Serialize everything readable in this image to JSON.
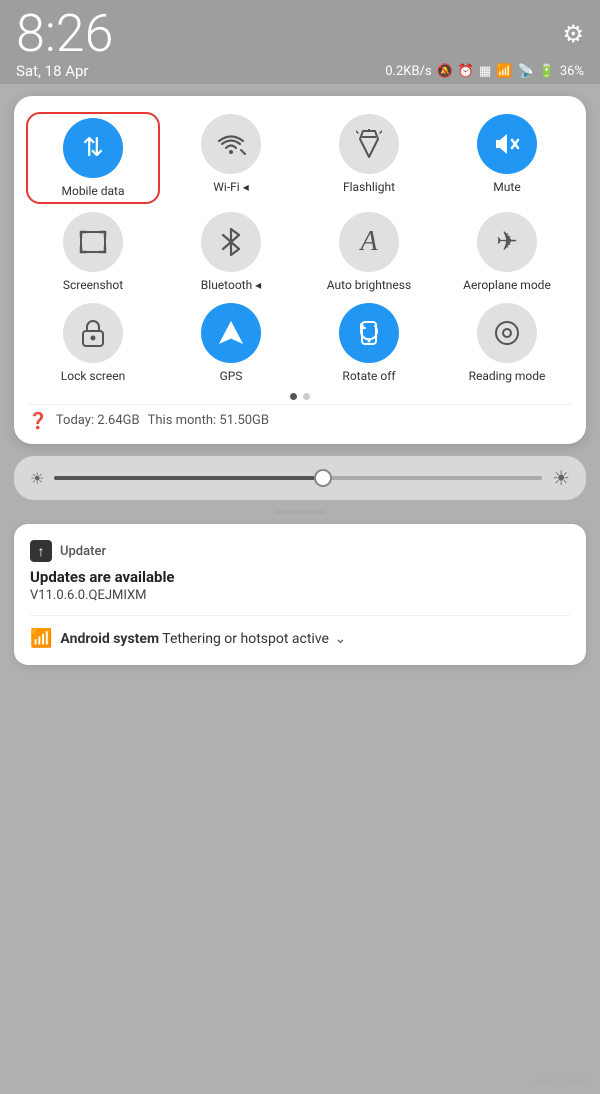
{
  "statusBar": {
    "time": "8:26",
    "date": "Sat, 18 Apr",
    "speed": "0.2KB/s",
    "battery": "36%"
  },
  "quickPanel": {
    "tiles": [
      {
        "id": "mobile-data",
        "label": "Mobile data",
        "icon": "⇅",
        "active": true,
        "selected": true
      },
      {
        "id": "wifi",
        "label": "Wi-Fi",
        "icon": "📶",
        "active": false
      },
      {
        "id": "flashlight",
        "label": "Flashlight",
        "icon": "🔦",
        "active": false
      },
      {
        "id": "mute",
        "label": "Mute",
        "icon": "🔕",
        "active": true
      },
      {
        "id": "screenshot",
        "label": "Screenshot",
        "icon": "⊞",
        "active": false
      },
      {
        "id": "bluetooth",
        "label": "Bluetooth",
        "icon": "⬡",
        "active": false
      },
      {
        "id": "auto-brightness",
        "label": "Auto brightness",
        "icon": "A",
        "active": false
      },
      {
        "id": "aeroplane-mode",
        "label": "Aeroplane mode",
        "icon": "✈",
        "active": false
      },
      {
        "id": "lock-screen",
        "label": "Lock screen",
        "icon": "🔒",
        "active": false
      },
      {
        "id": "gps",
        "label": "GPS",
        "icon": "◎",
        "active": true
      },
      {
        "id": "rotate-off",
        "label": "Rotate off",
        "icon": "↺",
        "active": true
      },
      {
        "id": "reading-mode",
        "label": "Reading mode",
        "icon": "◉",
        "active": false
      }
    ],
    "dots": [
      {
        "active": true
      },
      {
        "active": false
      }
    ],
    "dataUsage": {
      "today": "Today: 2.64GB",
      "thisMonth": "This month: 51.50GB"
    }
  },
  "notifications": [
    {
      "appIcon": "↑",
      "appName": "Updater",
      "title": "Updates are available",
      "body": "V11.0.6.0.QEJMIXM"
    }
  ],
  "androidSystem": {
    "label": "Android system",
    "text": "Tethering or hotspot active"
  },
  "watermark": "wsxdn.com"
}
